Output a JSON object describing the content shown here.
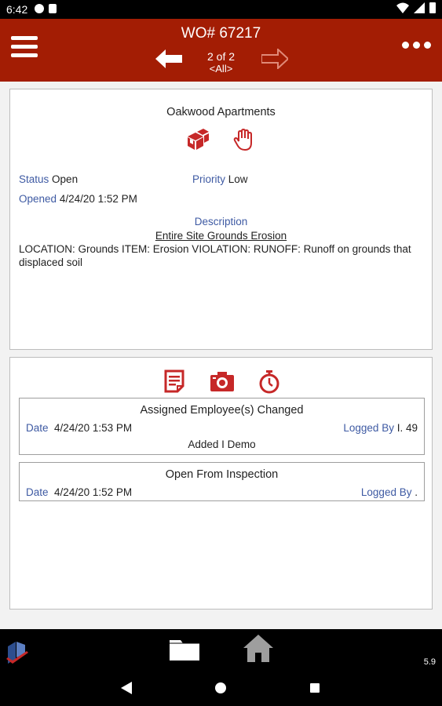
{
  "status_bar": {
    "time": "6:42",
    "icons": [
      "g-icon",
      "sd-card-icon",
      "wifi-icon",
      "signal-icon",
      "battery-icon"
    ]
  },
  "header": {
    "title": "WO# 67217",
    "pager": "2 of 2",
    "filter": "<All>",
    "icons": [
      "menu-icon",
      "arrow-left-icon",
      "arrow-right-icon",
      "more-dots-icon"
    ]
  },
  "work_order": {
    "property": "Oakwood Apartments",
    "status_label": "Status",
    "status_value": "Open",
    "priority_label": "Priority",
    "priority_value": "Low",
    "opened_label": "Opened",
    "opened_value": "4/24/20 1:52 PM",
    "description_label": "Description",
    "description_title": "Entire Site Grounds Erosion",
    "description_body": "LOCATION: Grounds ITEM: Erosion VIOLATION: RUNOFF: Runoff on grounds that displaced soil",
    "icons": [
      "boxes-icon",
      "hand-stop-icon"
    ]
  },
  "activity": {
    "icons": [
      "note-icon",
      "camera-icon",
      "stopwatch-icon"
    ],
    "logs": [
      {
        "title": "Assigned Employee(s) Changed",
        "date_label": "Date",
        "date_value": "4/24/20 1:53 PM",
        "logged_label": "Logged By",
        "logged_value": "I. 49",
        "note": "Added I Demo"
      },
      {
        "title": "Open From Inspection",
        "date_label": "Date",
        "date_value": "4/24/20 1:52 PM",
        "logged_label": "Logged By",
        "logged_value": "."
      }
    ]
  },
  "bottom_bar": {
    "version": "5.9",
    "icons": [
      "logo-icon",
      "folder-icon",
      "home-icon"
    ]
  },
  "colors": {
    "brand_red": "#a31d04",
    "label_blue": "#3e5aa3",
    "panel_border": "#bdbdbd",
    "icon_red": "#c62828"
  }
}
